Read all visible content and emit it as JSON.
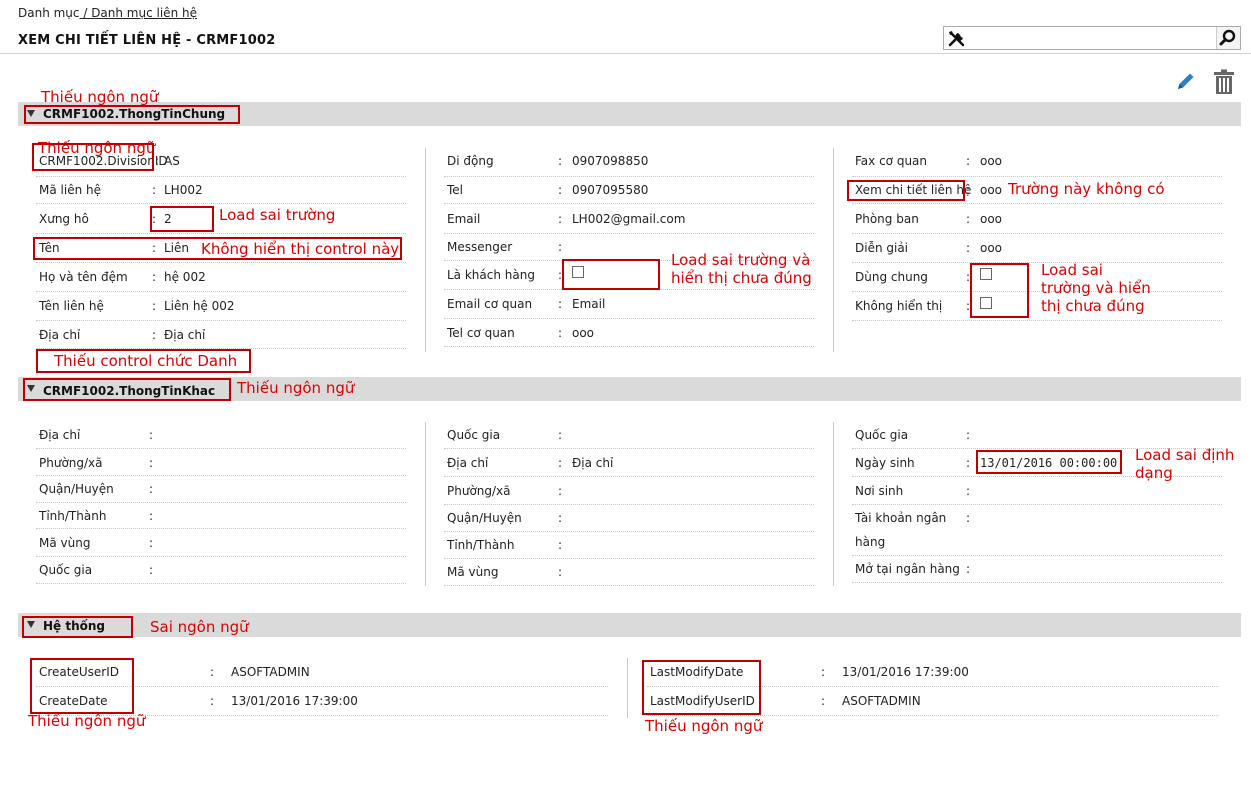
{
  "breadcrumb": {
    "root": "Danh mục",
    "sep": " /",
    "current": " Danh mục liên hệ"
  },
  "page_title": "XEM CHI TIẾT LIÊN HỆ - CRMF1002",
  "search": {
    "placeholder": ""
  },
  "icons": {
    "tools": "tools-icon",
    "search": "search-icon",
    "edit": "edit-icon",
    "delete": "trash-icon"
  },
  "sections": {
    "general": "CRMF1002.ThongTinChung",
    "other": "CRMF1002.ThongTinKhac",
    "system": "Hệ thống"
  },
  "general": {
    "col1": [
      {
        "label": "CRMF1002.DivisionID",
        "value": "AS"
      },
      {
        "label": "Mã liên hệ",
        "value": "LH002"
      },
      {
        "label": "Xưng hô",
        "value": "2"
      },
      {
        "label": "Tên",
        "value": "Liên"
      },
      {
        "label": "Họ và tên đệm",
        "value": "hệ 002"
      },
      {
        "label": "Tên liên hệ",
        "value": "Liên hệ 002"
      },
      {
        "label": "Địa chỉ",
        "value": "Địa chỉ"
      }
    ],
    "col2": [
      {
        "label": "Di động",
        "value": "0907098850"
      },
      {
        "label": "Tel",
        "value": "0907095580"
      },
      {
        "label": "Email",
        "value": "LH002@gmail.com"
      },
      {
        "label": "Messenger",
        "value": ""
      },
      {
        "label": "Là khách hàng",
        "checked": false
      },
      {
        "label": "Email cơ quan",
        "value": "Email"
      },
      {
        "label": "Tel cơ quan",
        "value": "ooo"
      }
    ],
    "col3": [
      {
        "label": "Fax cơ quan",
        "value": "ooo"
      },
      {
        "label": "Xem chi tiết liên hệ",
        "value": "ooo"
      },
      {
        "label": "Phòng ban",
        "value": "ooo"
      },
      {
        "label": "Diễn giải",
        "value": "ooo"
      },
      {
        "label": "Dùng chung",
        "checked": false
      },
      {
        "label": "Không hiển thị",
        "checked": false
      }
    ]
  },
  "other": {
    "col1": [
      {
        "label": "Địa chỉ",
        "value": ""
      },
      {
        "label": "Phường/xã",
        "value": ""
      },
      {
        "label": "Quận/Huyện",
        "value": ""
      },
      {
        "label": "Tỉnh/Thành",
        "value": ""
      },
      {
        "label": "Mã vùng",
        "value": ""
      },
      {
        "label": "Quốc gia",
        "value": ""
      }
    ],
    "col2": [
      {
        "label": "Quốc gia",
        "value": ""
      },
      {
        "label": "Địa chỉ",
        "value": "Địa chỉ"
      },
      {
        "label": "Phường/xã",
        "value": ""
      },
      {
        "label": "Quận/Huyện",
        "value": ""
      },
      {
        "label": "Tỉnh/Thành",
        "value": ""
      },
      {
        "label": "Mã vùng",
        "value": ""
      }
    ],
    "col3": [
      {
        "label": "Quốc gia",
        "value": ""
      },
      {
        "label": "Ngày sinh",
        "value": "13/01/2016 00:00:00"
      },
      {
        "label": "Nơi sinh",
        "value": ""
      },
      {
        "label": "Tài khoản ngân",
        "label2": "hàng",
        "value": ""
      },
      {
        "label": "Mở tại ngân hàng",
        "value": ""
      }
    ]
  },
  "system": {
    "left": [
      {
        "label": "CreateUserID",
        "value": "ASOFTADMIN"
      },
      {
        "label": "CreateDate",
        "value": "13/01/2016 17:39:00"
      }
    ],
    "right": [
      {
        "label": "LastModifyDate",
        "value": "13/01/2016 17:39:00"
      },
      {
        "label": "LastModifyUserID",
        "value": "ASOFTADMIN"
      }
    ]
  },
  "annotations": {
    "a1": "Thiếu ngôn ngữ",
    "a2": "Thiếu ngôn ngữ",
    "a3": "Load sai trường",
    "a4": "Không hiển thị control này",
    "a5": "Load sai trường và",
    "a5b": "hiển thị chưa đúng",
    "a6": "Trường này không có",
    "a7": "Load sai",
    "a7b": "trường và hiển",
    "a7c": "thị chưa đúng",
    "a8": "Thiếu control chức Danh",
    "a9": "Thiếu ngôn ngữ",
    "a10": "Load sai định",
    "a10b": "dạng",
    "a11": "Sai ngôn ngữ",
    "a12": "Thiếu ngôn ngữ",
    "a13": "Thiếu ngôn ngữ"
  }
}
